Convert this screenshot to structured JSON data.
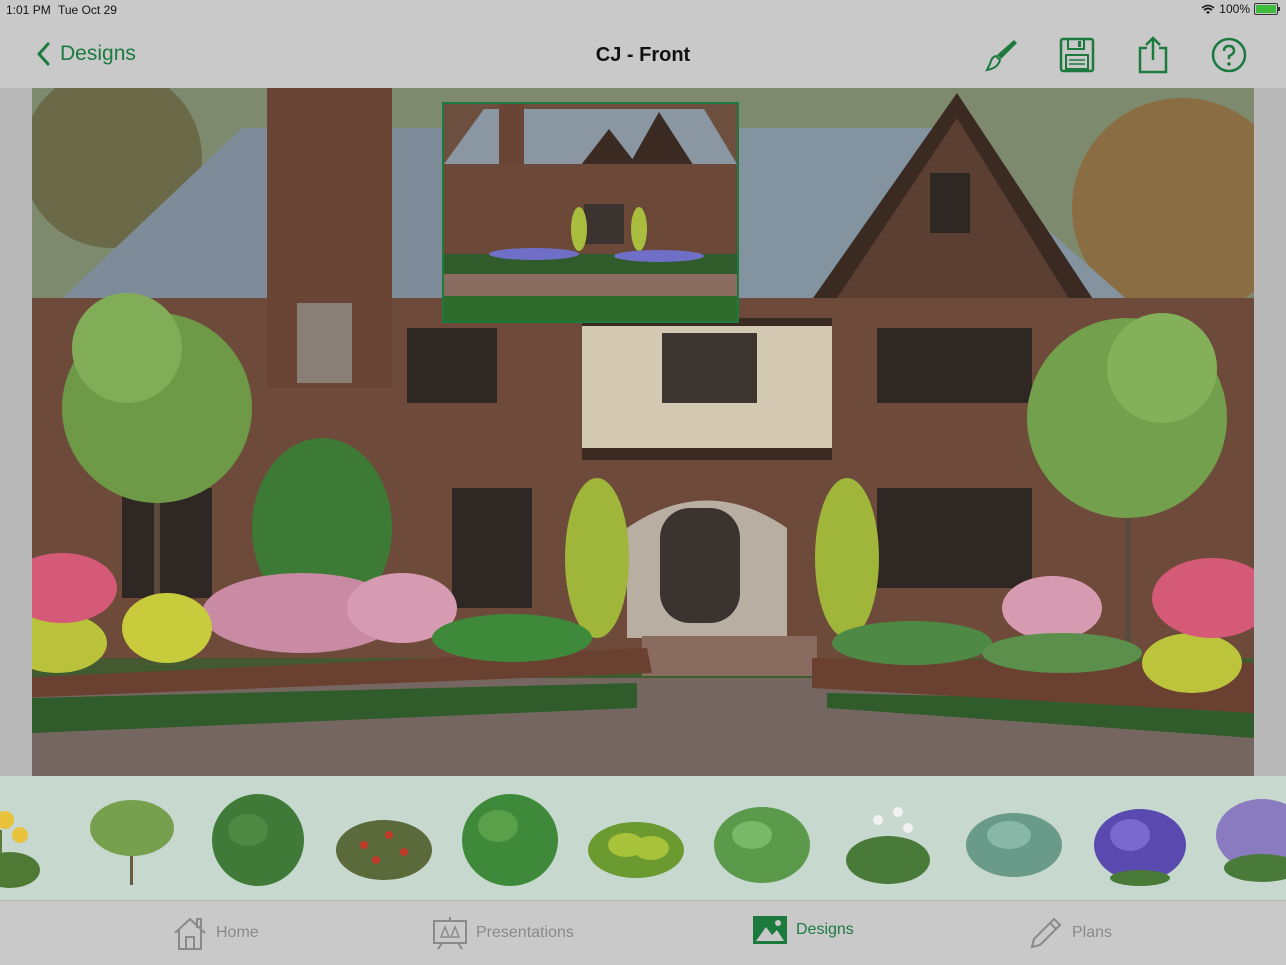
{
  "status": {
    "time": "1:01 PM",
    "date": "Tue Oct 29",
    "battery": "100%"
  },
  "nav": {
    "back_label": "Designs",
    "title": "CJ - Front"
  },
  "tabs": [
    {
      "label": "Home"
    },
    {
      "label": "Presentations"
    },
    {
      "label": "Designs"
    },
    {
      "label": "Plans"
    }
  ],
  "colors": {
    "accent": "#1d7a3f",
    "inactive": "#8a8a8a"
  },
  "icons": [
    "chevron-left-icon",
    "paint-brush-icon",
    "save-icon",
    "share-icon",
    "help-icon",
    "home-icon",
    "presentations-icon",
    "designs-icon",
    "plans-icon"
  ]
}
